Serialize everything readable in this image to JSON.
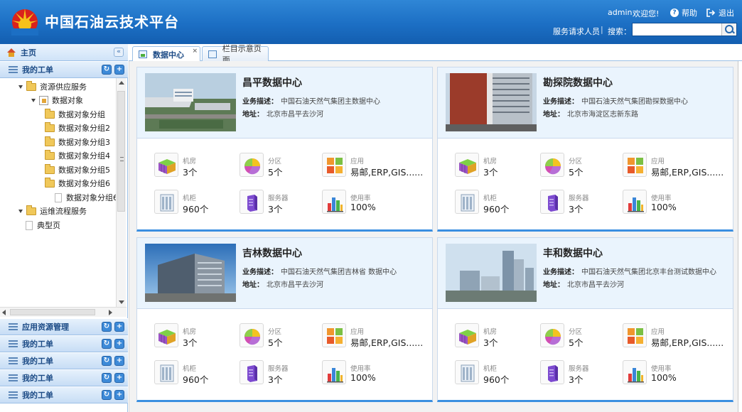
{
  "header": {
    "app_title": "中国石油云技术平台",
    "user_name": "admin",
    "welcome": "欢迎您!",
    "help": "帮助",
    "logout": "退出",
    "role": "服务请求人员",
    "separator": "|",
    "search_label": "搜索：",
    "search_value": "",
    "search_placeholder": ""
  },
  "sidebar": {
    "home": "主页",
    "collapse_glyph": "«",
    "my_ticket": "我的工单",
    "tree": [
      {
        "label": "资源供应服务",
        "level": 1
      },
      {
        "label": "数据对象",
        "level": 2
      },
      {
        "label": "数据对象分组",
        "level": 3
      },
      {
        "label": "数据对象分组2",
        "level": 3
      },
      {
        "label": "数据对象分组3",
        "level": 3
      },
      {
        "label": "数据对象分组4",
        "level": 3
      },
      {
        "label": "数据对象分组5",
        "level": 3
      },
      {
        "label": "数据对象分组6",
        "level": 3
      },
      {
        "label": "数据对象分组6",
        "level": 4
      },
      {
        "label": "运维流程服务",
        "level": 1
      },
      {
        "label": "典型页",
        "level": 1
      }
    ],
    "bottom_bars": [
      "应用资源管理",
      "我的工单",
      "我的工单",
      "我的工单",
      "我的工单"
    ],
    "refresh_glyph": "↻",
    "add_glyph": "+"
  },
  "tabs": [
    {
      "label": "数据中心",
      "close": "×"
    },
    {
      "label": "栏目示意页面"
    }
  ],
  "labels": {
    "desc": "业务描述：",
    "addr": "地址：",
    "room": "机房",
    "partition": "分区",
    "app": "应用",
    "cabinet": "机柜",
    "server": "服务器",
    "usage": "使用率"
  },
  "cards": [
    {
      "name": "昌平数据中心",
      "desc": "中国石油天然气集团主数据中心",
      "addr": "北京市昌平去沙河",
      "room": "3个",
      "partition": "5个",
      "app": "易邮,ERP,GIS......",
      "cabinet": "960个",
      "server": "3个",
      "usage": "100%"
    },
    {
      "name": "勘探院数据中心",
      "desc": "中国石油天然气集团勘探数据中心",
      "addr": "北京市海淀区志新东路",
      "room": "3个",
      "partition": "5个",
      "app": "易邮,ERP,GIS......",
      "cabinet": "960个",
      "server": "3个",
      "usage": "100%"
    },
    {
      "name": "吉林数据中心",
      "desc": "中国石油天然气集团吉林省 数据中心",
      "addr": "北京市昌平去沙河",
      "room": "3个",
      "partition": "5个",
      "app": "易邮,ERP,GIS......",
      "cabinet": "960个",
      "server": "3个",
      "usage": "100%"
    },
    {
      "name": "丰和数据中心",
      "desc": "中国石油天然气集团北京丰台测试数据中心",
      "addr": "北京市昌平去沙河",
      "room": "3个",
      "partition": "5个",
      "app": "易邮,ERP,GIS......",
      "cabinet": "960个",
      "server": "3个",
      "usage": "100%"
    }
  ],
  "colors": {
    "header_blue": "#1c6fc4",
    "accent_blue": "#3a8fe0",
    "logo_red": "#d9221c",
    "logo_yellow": "#f6c21a"
  }
}
